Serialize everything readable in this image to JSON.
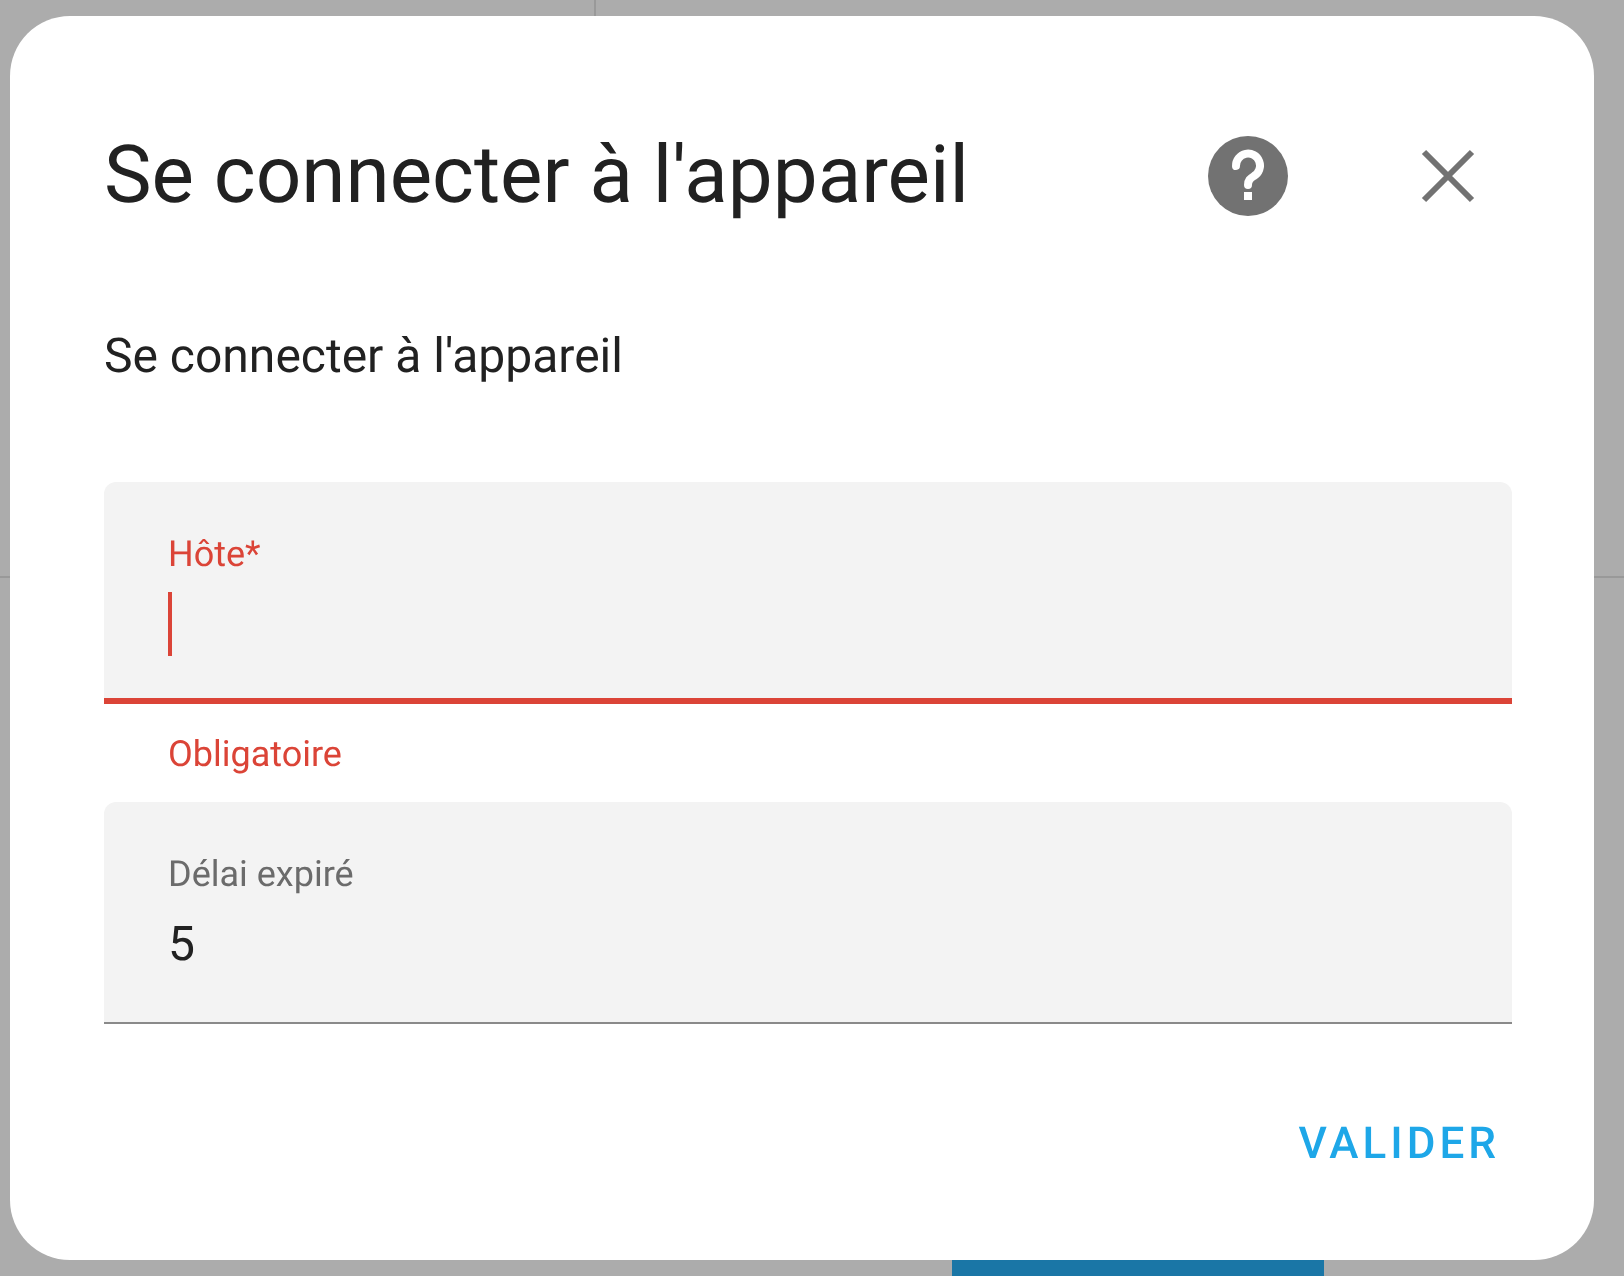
{
  "dialog": {
    "title": "Se connecter à l'appareil",
    "subtitle": "Se connecter à l'appareil",
    "fields": [
      {
        "label": "Hôte*",
        "focused": true,
        "invalid": true,
        "helper": "Obligatoire"
      },
      {
        "label": "Délai expiré",
        "value": "5",
        "focused": false,
        "invalid": false
      }
    ],
    "buttons": [
      "VALIDER"
    ]
  }
}
